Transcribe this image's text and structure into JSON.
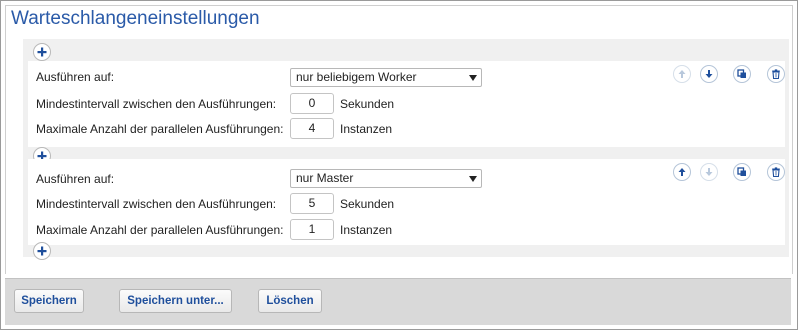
{
  "page_title": "Warteschlangeneinstellungen",
  "labels": {
    "run_on": "Ausführen auf:",
    "min_interval": "Mindestintervall zwischen den Ausführungen:",
    "max_parallel": "Maximale Anzahl der parallelen Ausführungen:"
  },
  "units": {
    "seconds": "Sekunden",
    "instances": "Instanzen"
  },
  "queues": [
    {
      "run_on": "nur beliebigem Worker",
      "min_interval": "0",
      "max_parallel": "4",
      "move_up_enabled": false,
      "move_down_enabled": true
    },
    {
      "run_on": "nur Master",
      "min_interval": "5",
      "max_parallel": "1",
      "move_up_enabled": true,
      "move_down_enabled": false
    }
  ],
  "footer": {
    "save": "Speichern",
    "save_as": "Speichern unter...",
    "delete": "Löschen"
  },
  "icons": {
    "add": "plus-icon",
    "move_up": "arrow-up-icon",
    "move_down": "arrow-down-icon",
    "duplicate": "copy-icon",
    "delete": "trash-icon"
  },
  "colors": {
    "accent": "#2a5aa8",
    "icon_blue": "#1f4f9c",
    "footer_bg": "#d9d9d9"
  }
}
